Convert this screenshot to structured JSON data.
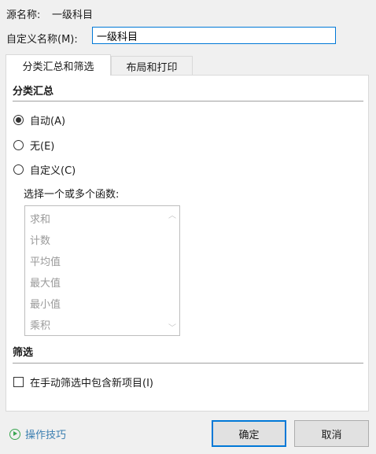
{
  "source": {
    "label": "源名称:",
    "value": "一级科目"
  },
  "custom_name": {
    "label": "自定义名称(M):",
    "value": "一级科目"
  },
  "tabs": [
    {
      "label": "分类汇总和筛选",
      "active": true
    },
    {
      "label": "布局和打印",
      "active": false
    }
  ],
  "subtotals": {
    "title": "分类汇总",
    "options": [
      {
        "label": "自动(A)",
        "checked": true
      },
      {
        "label": "无(E)",
        "checked": false
      },
      {
        "label": "自定义(C)",
        "checked": false
      }
    ],
    "function_prompt": "选择一个或多个函数:",
    "functions": [
      "求和",
      "计数",
      "平均值",
      "最大值",
      "最小值",
      "乘积"
    ]
  },
  "filter": {
    "title": "筛选",
    "include_new_items_label": "在手动筛选中包含新项目(I)",
    "include_new_items_checked": false
  },
  "footer": {
    "tips_label": "操作技巧",
    "ok_label": "确定",
    "cancel_label": "取消"
  },
  "colors": {
    "accent": "#0078d7",
    "tips": "#3c7fb1",
    "tips_icon": "#3aa651"
  }
}
